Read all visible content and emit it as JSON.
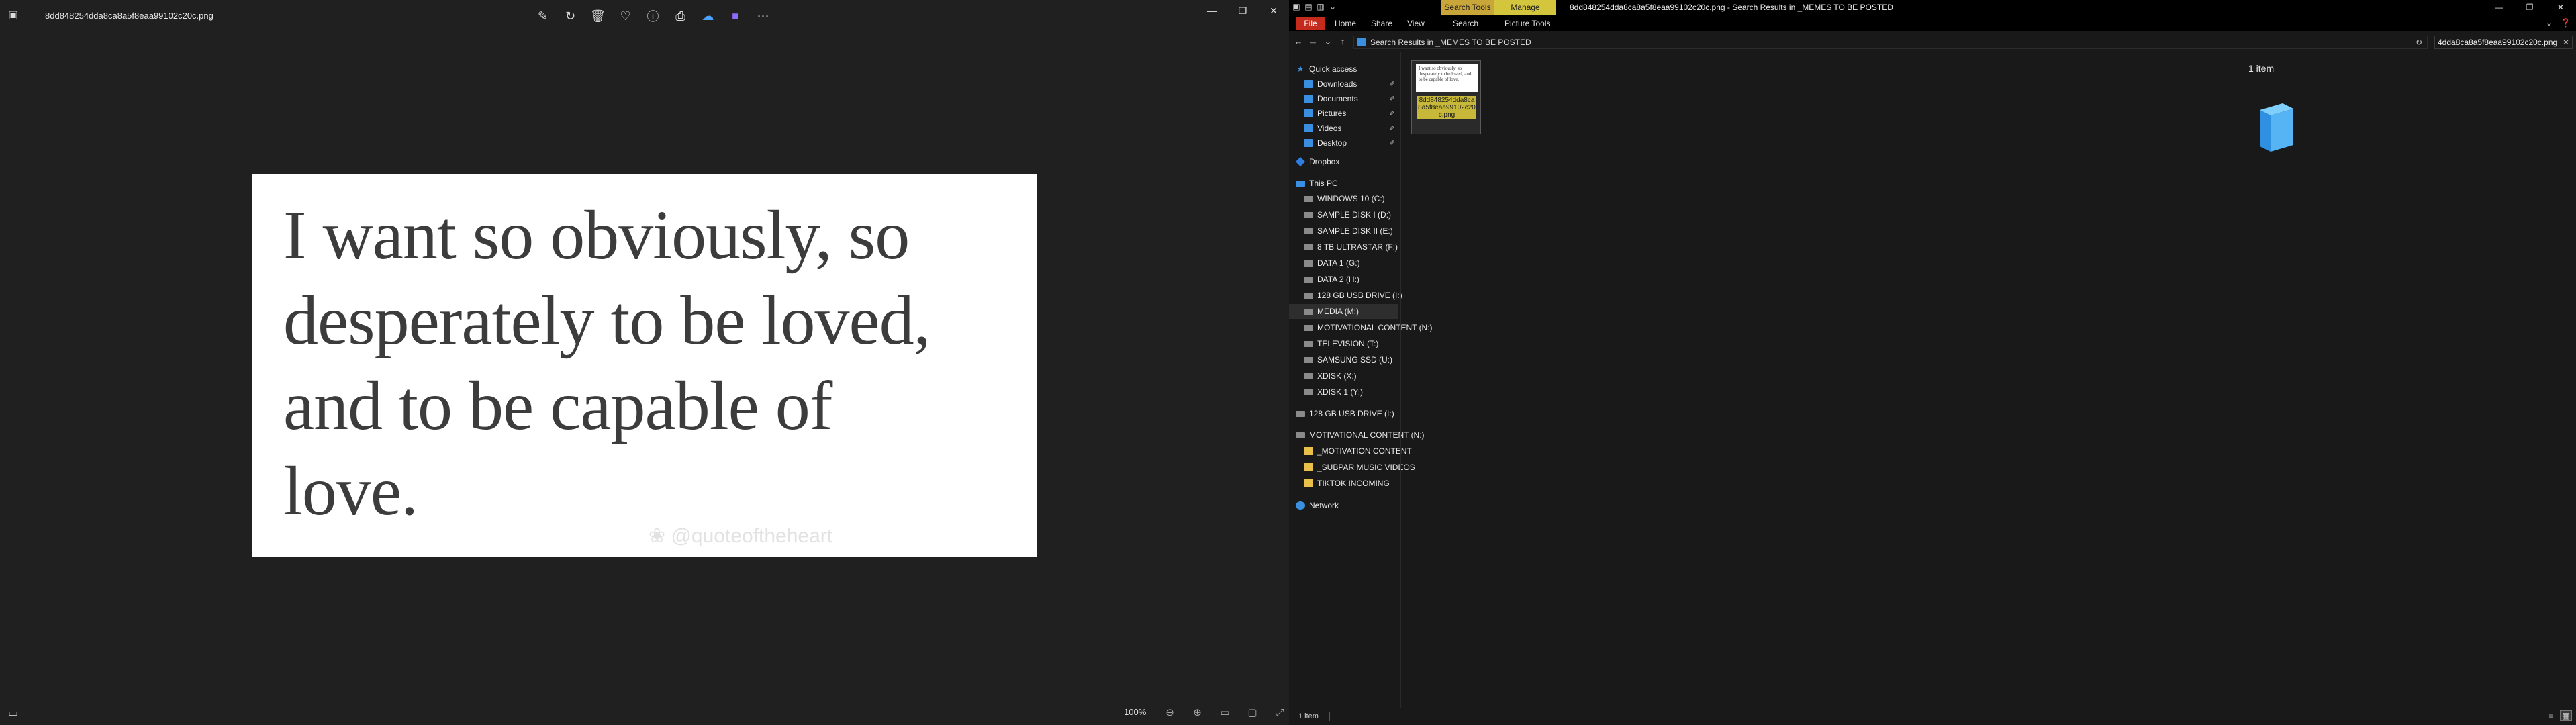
{
  "photos": {
    "filename": "8dd848254dda8ca8a5f8eaa99102c20c.png",
    "quote_lines": [
      "I want so obviously, so",
      "desperately to be loved,",
      "and to be capable of",
      "love."
    ],
    "watermark": "❀ @quoteoftheheart",
    "zoom": "100%",
    "icons": {
      "app": "photos-app-icon",
      "tools": [
        "edit-image-icon",
        "rotate-icon",
        "delete-icon",
        "favorite-icon",
        "info-icon",
        "print-icon",
        "onedrive-icon",
        "clipchamp-icon",
        "more-icon"
      ],
      "window": [
        "minimize-icon",
        "restore-icon",
        "close-icon"
      ],
      "bottom": [
        "zoom-out-icon",
        "zoom-in-icon",
        "fit-to-window-icon",
        "actual-size-icon",
        "fullscreen-icon"
      ]
    }
  },
  "explorer": {
    "context_tab_search": "Search Tools",
    "context_tab_manage": "Manage",
    "title": "8dd848254dda8ca8a5f8eaa99102c20c.png - Search Results in _MEMES TO BE POSTED",
    "ribbon_tabs": {
      "file": "File",
      "home": "Home",
      "share": "Share",
      "view": "View",
      "search": "Search",
      "picture_tools": "Picture Tools"
    },
    "address": "Search Results in _MEMES TO BE POSTED",
    "search_value": "4dda8ca8a5f8eaa99102c20c.png",
    "nav": {
      "quick_access": "Quick access",
      "downloads": "Downloads",
      "documents": "Documents",
      "pictures": "Pictures",
      "videos": "Videos",
      "desktop": "Desktop",
      "dropbox": "Dropbox",
      "this_pc": "This PC",
      "drives": [
        "WINDOWS 10 (C:)",
        "SAMPLE DISK I (D:)",
        "SAMPLE DISK II (E:)",
        "8 TB ULTRASTAR (F:)",
        "DATA 1 (G:)",
        "DATA 2 (H:)",
        "128 GB USB DRIVE (I:)",
        "MEDIA (M:)",
        "MOTIVATIONAL CONTENT (N:)",
        "TELEVISION (T:)",
        "SAMSUNG SSD (U:)",
        "XDISK (X:)",
        "XDISK 1 (Y:)"
      ],
      "usb_drive": "128 GB USB DRIVE (I:)",
      "motivational": "MOTIVATIONAL CONTENT (N:)",
      "motivational_children": [
        "_MOTIVATION CONTENT",
        "_SUBPAR MUSIC VIDEOS",
        "TIKTOK INCOMING"
      ],
      "network": "Network"
    },
    "file_label": "8dd848254dda8ca8a5f8eaa99102c20c.png",
    "thumb_text": "I want so obviously, so desperately to be loved, and to be capable of love.",
    "preview_count": "1 item",
    "status": "1 item"
  }
}
